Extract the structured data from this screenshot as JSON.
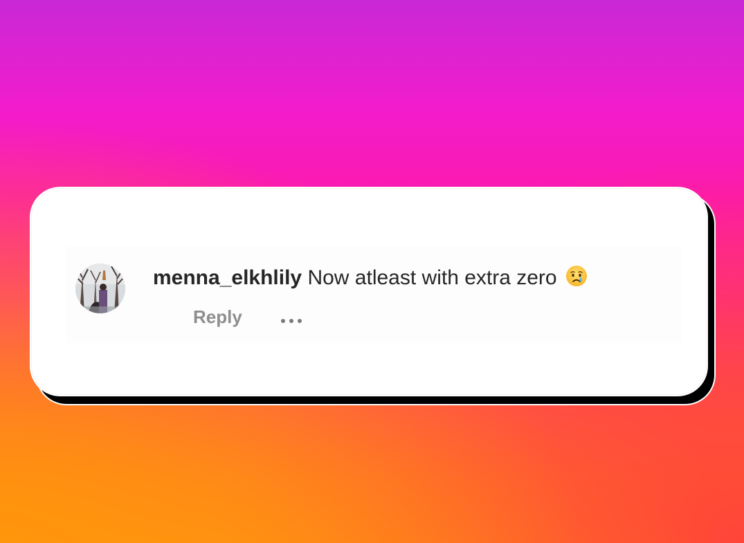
{
  "comment": {
    "username": "menna_elkhlily",
    "text": "Now atleast with extra zero",
    "emoji_icon": "crying-face-emoji-icon",
    "reply_label": "Reply",
    "more_icon": "more-options-icon"
  },
  "colors": {
    "username": "#262626",
    "text": "#262626",
    "secondary": "#8e8e8e",
    "card_background": "#ffffff",
    "card_shadow": "#000000"
  }
}
